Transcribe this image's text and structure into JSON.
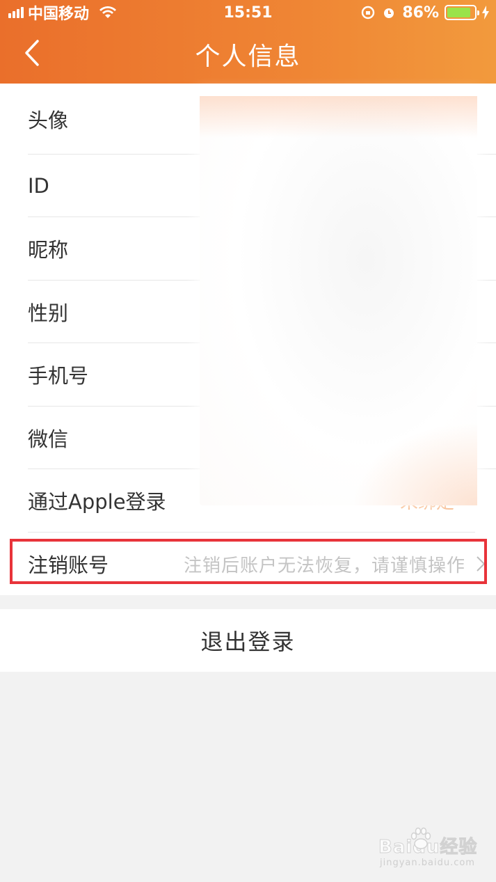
{
  "status_bar": {
    "carrier": "中国移动",
    "time": "15:51",
    "battery": "86%",
    "battery_level": 0.86
  },
  "nav": {
    "title": "个人信息",
    "back_icon": "chevron-left-icon"
  },
  "rows": [
    {
      "label": "头像"
    },
    {
      "label": "ID"
    },
    {
      "label": "昵称"
    },
    {
      "label": "性别"
    },
    {
      "label": "手机号"
    },
    {
      "label": "微信"
    },
    {
      "label": "通过Apple登录",
      "value": "未绑定"
    }
  ],
  "cancel_account": {
    "label": "注销账号",
    "hint": "注销后账户无法恢复，请谨慎操作"
  },
  "logout": {
    "label": "退出登录"
  },
  "watermark": {
    "brand": "Baidu经验",
    "url": "jingyan.baidu.com"
  },
  "colors": {
    "header_start": "#ea6f2b",
    "header_end": "#f29a3d",
    "highlight": "#e8333a",
    "accent": "#f0883a"
  }
}
